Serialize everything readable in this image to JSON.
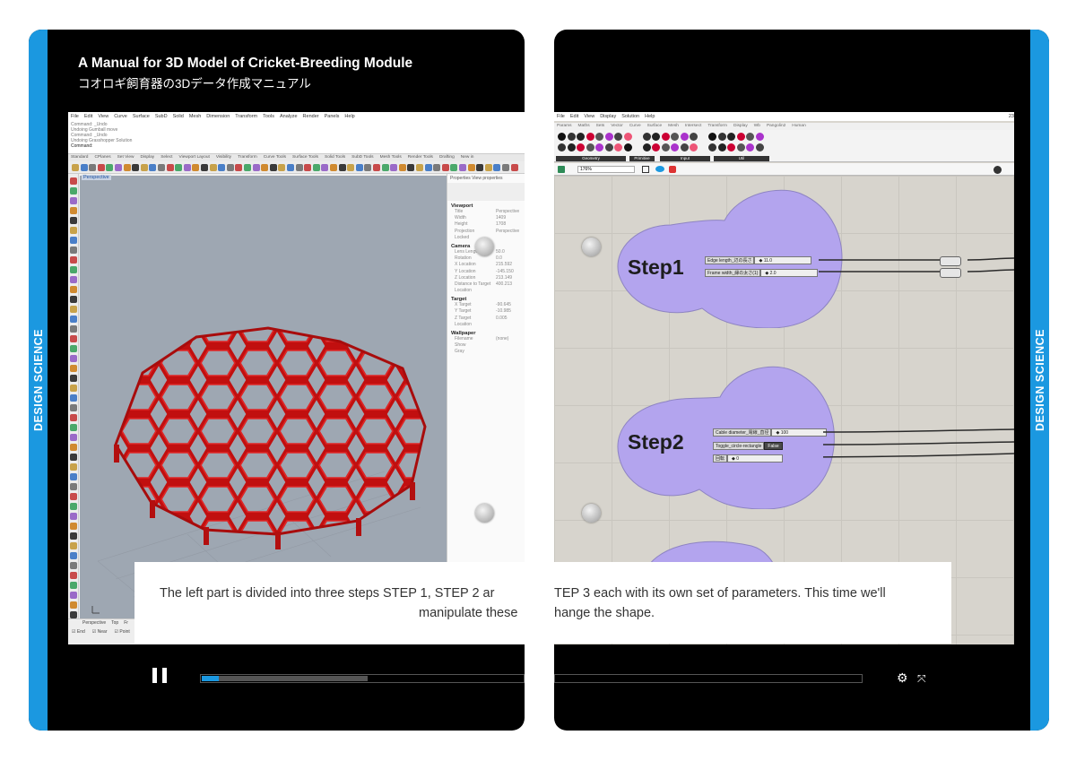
{
  "spine": {
    "left_label": "DESIGN SCIENCE",
    "right_label": "DESIGN SCIENCE",
    "color": "#1b98e0"
  },
  "header": {
    "title_en": "A Manual for 3D Model of Cricket-Breeding Module",
    "title_jp": "コオロギ飼育器の3Dデータ作成マニュアル"
  },
  "rhino": {
    "menu": [
      "File",
      "Edit",
      "View",
      "Curve",
      "Surface",
      "SubD",
      "Solid",
      "Mesh",
      "Dimension",
      "Transform",
      "Tools",
      "Analyze",
      "Render",
      "Panels",
      "Help"
    ],
    "command_history": [
      "Command: _Undo",
      "Undoing Gumball move",
      "Command: _Undo",
      "Undoing Grasshopper Solution"
    ],
    "command_prompt": "Command:",
    "toolbar_tabs": [
      "Standard",
      "CPlanes",
      "Set View",
      "Display",
      "Select",
      "Viewport Layout",
      "Visibility",
      "Transform",
      "Curve Tools",
      "Surface Tools",
      "Solid Tools",
      "SubD Tools",
      "Mesh Tools",
      "Render Tools",
      "Drafting",
      "New in"
    ],
    "viewport_label": "Perspective",
    "panel": {
      "tabs": "Properties  View properties",
      "viewport_section": "Viewport",
      "viewport_rows": [
        [
          "Title",
          "Perspective"
        ],
        [
          "Width",
          "1409"
        ],
        [
          "Height",
          "1708"
        ],
        [
          "Projection",
          "Perspective"
        ],
        [
          "Locked",
          ""
        ]
      ],
      "camera_section": "Camera",
      "camera_rows": [
        [
          "Lens Length (mm)",
          "50.0"
        ],
        [
          "Rotation",
          "0.0"
        ],
        [
          "X Location",
          "215.592"
        ],
        [
          "Y Location",
          "-145.150"
        ],
        [
          "Z Location",
          "213.149"
        ],
        [
          "Distance to Target",
          "400.213"
        ],
        [
          "Location",
          ""
        ]
      ],
      "target_section": "Target",
      "target_rows": [
        [
          "X Target",
          "-90.645"
        ],
        [
          "Y Target",
          "-10.985"
        ],
        [
          "Z Target",
          "0.005"
        ],
        [
          "Location",
          ""
        ]
      ],
      "wallpaper_section": "Wallpaper",
      "wallpaper_rows": [
        [
          "Filename",
          "(none)"
        ],
        [
          "Show",
          ""
        ],
        [
          "Gray",
          ""
        ]
      ]
    },
    "bottom_tabs": [
      "Perspective",
      "Top",
      "Fr"
    ],
    "osnaps": [
      "End",
      "Near",
      "Point"
    ]
  },
  "grasshopper": {
    "menu": [
      "File",
      "Edit",
      "View",
      "Display",
      "Solution",
      "Help"
    ],
    "coord_readout": "23",
    "tabs": [
      "Params",
      "Maths",
      "Sets",
      "Vector",
      "Curve",
      "Surface",
      "Mesh",
      "Intersect",
      "Transform",
      "Display",
      "Wb",
      "Pangolin2",
      "Human"
    ],
    "categories": [
      "Geometry",
      "Primitive",
      "Input",
      "Util"
    ],
    "zoom": "176%",
    "steps": [
      {
        "label": "Step1",
        "sliders": [
          {
            "name": "Edge length_辺の長さ",
            "value": "11.0"
          },
          {
            "name": "Frame width_縁の太さ(1)",
            "value": "2.0"
          }
        ]
      },
      {
        "label": "Step2",
        "sliders": [
          {
            "name": "Cable diameter_電線_直径",
            "value": "100"
          },
          {
            "name": "Toggle_circle-rectangle",
            "value": "False"
          },
          {
            "name": "回転",
            "value": "0"
          }
        ]
      }
    ],
    "blob_color": "#b3a4ee"
  },
  "subtitle": {
    "left_line1": "The left part is divided into three steps  STEP 1, STEP 2 ar",
    "left_line2": "manipulate these",
    "right_line1": "TEP 3  each with its own set of parameters. This time  we'll",
    "right_line2": "hange the shape."
  },
  "player": {
    "state": "playing",
    "progress_fraction": 0.025,
    "buffered_fraction": 0.25,
    "accent": "#1b98e0"
  }
}
